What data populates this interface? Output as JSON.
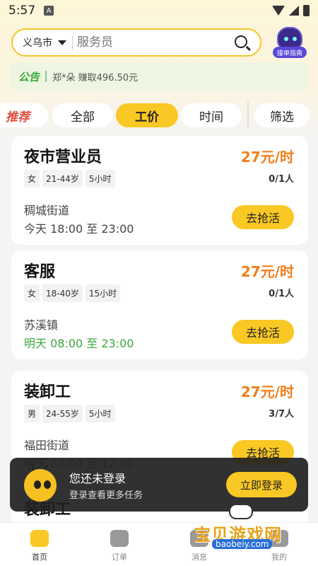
{
  "status_bar": {
    "time": "5:57",
    "a_badge": "A"
  },
  "search": {
    "city": "义乌市",
    "placeholder": "服务员"
  },
  "robot": {
    "label": "接单指南"
  },
  "notice": {
    "tag": "公告",
    "message": "郑*朵 赚取496.50元"
  },
  "tabs": [
    {
      "label": "推荐"
    },
    {
      "label": "全部"
    },
    {
      "label": "工价",
      "active": true
    },
    {
      "label": "时间"
    },
    {
      "label": "筛选"
    }
  ],
  "jobs": [
    {
      "title": "夜市营业员",
      "price": "27元/时",
      "tags": [
        "女",
        "21-44岁",
        "5小时"
      ],
      "count": "0/1人",
      "place": "稠城街道",
      "time": "今天 18:00 至 23:00",
      "time_color": "default",
      "button": "去抢活"
    },
    {
      "title": "客服",
      "price": "27元/时",
      "tags": [
        "女",
        "18-40岁",
        "15小时"
      ],
      "count": "0/1人",
      "place": "苏溪镇",
      "time": "明天 08:00 至 23:00",
      "time_color": "green",
      "button": "去抢活"
    },
    {
      "title": "装卸工",
      "price": "27元/时",
      "tags": [
        "男",
        "24-55岁",
        "5小时"
      ],
      "count": "3/7人",
      "place": "福田街道",
      "time": "明天 07:00 至 12:00",
      "time_color": "green",
      "button": "去抢活"
    },
    {
      "title": "装卸工"
    }
  ],
  "login_toast": {
    "title": "您还未登录",
    "subtitle": "登录查看更多任务",
    "button": "立即登录"
  },
  "bottom_nav": [
    {
      "label": "首页",
      "icon": "home-icon",
      "active": true
    },
    {
      "label": "订单",
      "icon": "order-icon"
    },
    {
      "label": "消息",
      "icon": "message-icon"
    },
    {
      "label": "我的",
      "icon": "profile-icon"
    }
  ],
  "watermark": {
    "title": "宝贝游戏网",
    "url": "baobeiy.com"
  },
  "colors": {
    "accent": "#f9c824",
    "price": "#f27d1a",
    "green": "#3aa83a"
  }
}
